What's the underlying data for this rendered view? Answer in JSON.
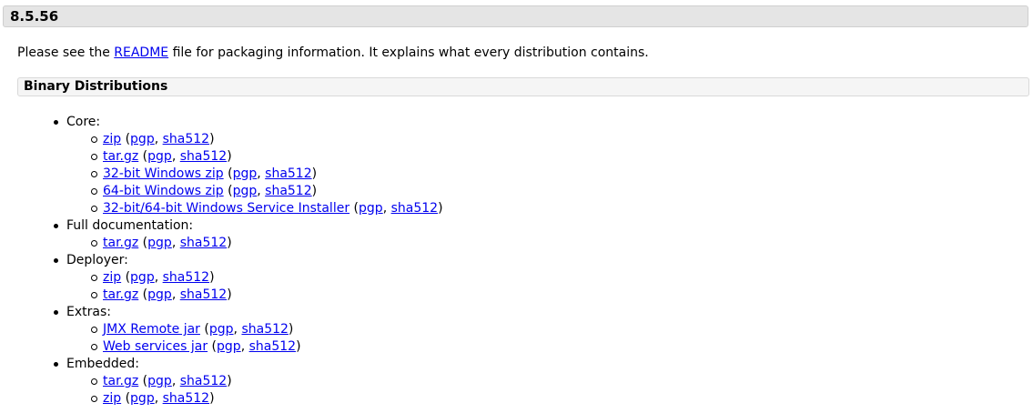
{
  "version": "8.5.56",
  "intro": {
    "before": "Please see the ",
    "link": "README",
    "after": " file for packaging information. It explains what every distribution contains."
  },
  "section_title": "Binary Distributions",
  "labels": {
    "pgp": "pgp",
    "sha512": "sha512"
  },
  "groups": [
    {
      "label": "Core:",
      "items": [
        "zip",
        "tar.gz",
        "32-bit Windows zip",
        "64-bit Windows zip",
        "32-bit/64-bit Windows Service Installer"
      ]
    },
    {
      "label": "Full documentation:",
      "items": [
        "tar.gz"
      ]
    },
    {
      "label": "Deployer:",
      "items": [
        "zip",
        "tar.gz"
      ]
    },
    {
      "label": "Extras:",
      "items": [
        "JMX Remote jar",
        "Web services jar"
      ]
    },
    {
      "label": "Embedded:",
      "items": [
        "tar.gz",
        "zip"
      ]
    }
  ]
}
